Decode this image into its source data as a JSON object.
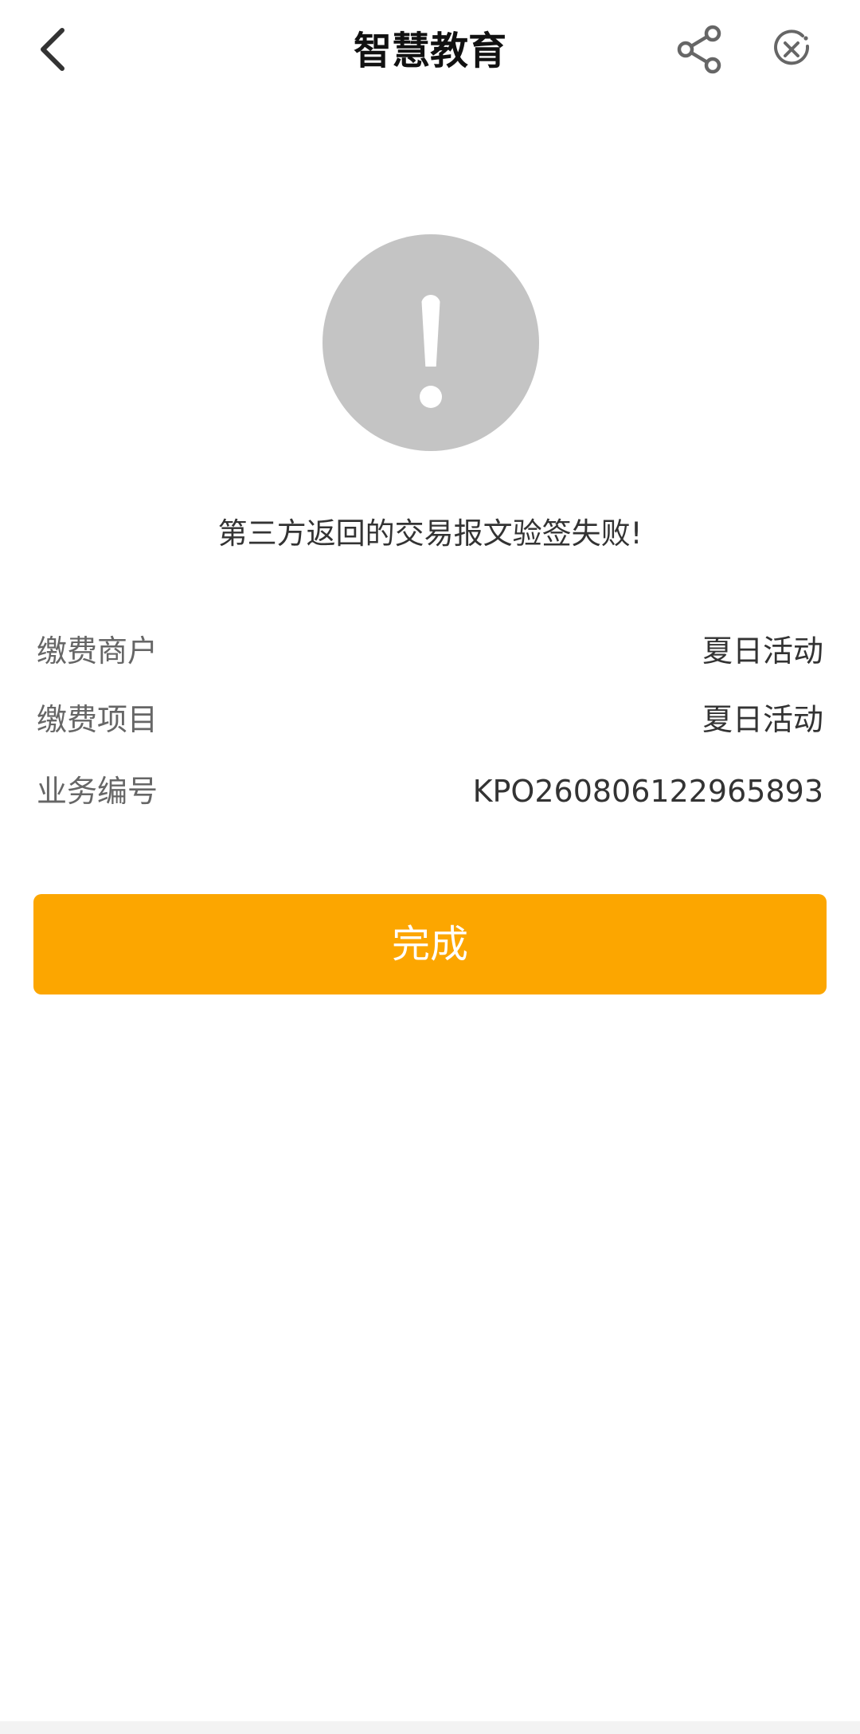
{
  "header": {
    "title": "智慧教育"
  },
  "status": {
    "icon": "exclamation-icon",
    "message": "第三方返回的交易报文验签失败!"
  },
  "details": [
    {
      "label": "缴费商户",
      "value": "夏日活动"
    },
    {
      "label": "缴费项目",
      "value": "夏日活动"
    },
    {
      "label": "业务编号",
      "value": "KPO260806122965893"
    }
  ],
  "actions": {
    "done_label": "完成"
  },
  "colors": {
    "accent": "#fca600",
    "status_icon_bg": "#c4c4c4"
  }
}
